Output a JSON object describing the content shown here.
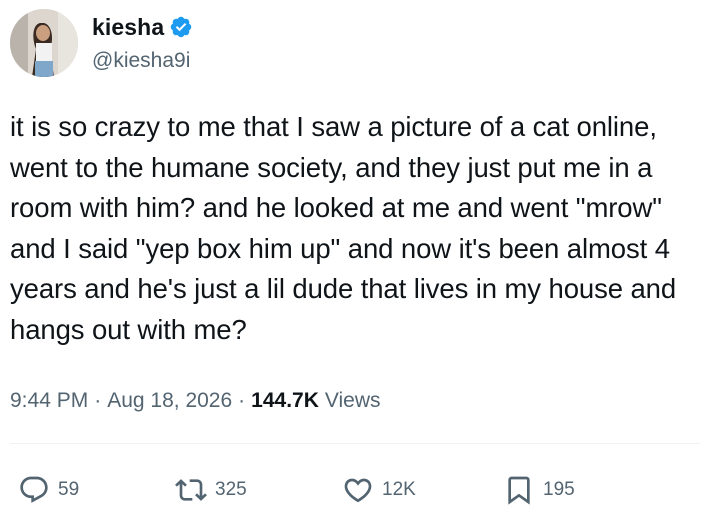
{
  "author": {
    "display_name": "kiesha",
    "handle": "@kiesha9i",
    "verified_color": "#1d9bf0"
  },
  "tweet": {
    "text": "it is so crazy to me that I saw a picture of a cat online, went to the humane society, and they just put me in a room with him? and he looked at me and went \"mrow\" and I said \"yep box him up\" and now it's been almost 4 years and he's just a lil dude that lives in my house and hangs out with me?",
    "time": "9:44 PM",
    "separator": "·",
    "date": "Aug 18, 2026",
    "views_count": "144.7K",
    "views_label": "Views"
  },
  "actions": {
    "reply_count": "59",
    "retweet_count": "325",
    "like_count": "12K",
    "bookmark_count": "195"
  },
  "icons": {
    "reply": "reply-icon",
    "retweet": "retweet-icon",
    "like": "heart-icon",
    "bookmark": "bookmark-icon",
    "verified": "verified-badge-icon"
  },
  "colors": {
    "text_primary": "#0f1419",
    "text_secondary": "#536471",
    "divider": "#eff3f4",
    "verified": "#1d9bf0"
  }
}
